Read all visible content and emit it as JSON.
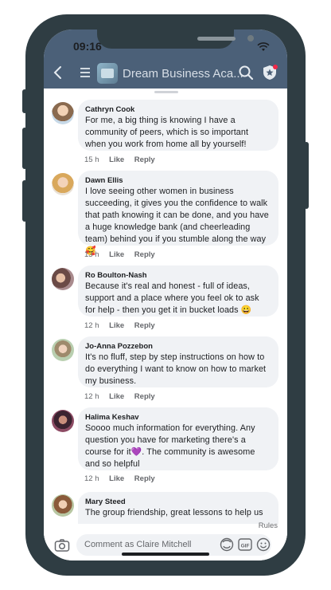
{
  "status_bar": {
    "time": "09:16"
  },
  "header": {
    "group_name": "Dream Business Aca..."
  },
  "comments": [
    {
      "author": "Cathryn Cook",
      "text": "For me, a big thing is knowing I have a community of peers, which is so important when you work from home all by yourself!",
      "time": "15 h",
      "like": "Like",
      "reply": "Reply",
      "avatar_color": "#c9a58a"
    },
    {
      "author": "Dawn Ellis",
      "text": "I love seeing other women in business succeeding, it gives you the confidence to walk that path knowing it can be done, and you have a huge knowledge bank (and cheerleading team) behind you if you stumble along the way 🥰",
      "time": "13 h",
      "like": "Like",
      "reply": "Reply",
      "avatar_color": "#d9b07a"
    },
    {
      "author": "Ro Boulton-Nash",
      "text": "Because it's real and honest - full of ideas, support and a place where you feel ok to ask for help - then you get it in bucket loads 😀",
      "time": "12 h",
      "like": "Like",
      "reply": "Reply",
      "avatar_color": "#8a6f72"
    },
    {
      "author": "Jo-Anna Pozzebon",
      "text": "It's no fluff, step by step instructions on how to do everything I want to know on how to market my business.",
      "time": "12 h",
      "like": "Like",
      "reply": "Reply",
      "avatar_color": "#9fb59a"
    },
    {
      "author": "Halima Keshav",
      "text": "Soooo much information for everything. Any question you have for marketing there's a course for it💜. The community is awesome and so helpful",
      "time": "12 h",
      "like": "Like",
      "reply": "Reply",
      "avatar_color": "#7a4a58"
    },
    {
      "author": "Mary Steed",
      "text": "The group friendship, great lessons to help us",
      "time": "",
      "like": "",
      "reply": "",
      "avatar_color": "#b08060"
    }
  ],
  "footer": {
    "rules_label": "Rules",
    "comment_placeholder": "Comment as Claire Mitchell"
  },
  "colors": {
    "header_bg": "#4b6078",
    "phone_frame": "#2f3d43",
    "bubble_bg": "#f0f2f5"
  }
}
